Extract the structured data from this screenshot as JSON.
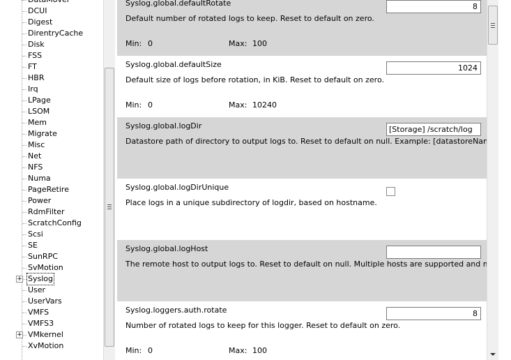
{
  "tree": {
    "items": [
      {
        "label": "DataMover",
        "expandable": false,
        "selected": false
      },
      {
        "label": "DCUI",
        "expandable": false,
        "selected": false
      },
      {
        "label": "Digest",
        "expandable": false,
        "selected": false
      },
      {
        "label": "DirentryCache",
        "expandable": false,
        "selected": false
      },
      {
        "label": "Disk",
        "expandable": false,
        "selected": false
      },
      {
        "label": "FSS",
        "expandable": false,
        "selected": false
      },
      {
        "label": "FT",
        "expandable": false,
        "selected": false
      },
      {
        "label": "HBR",
        "expandable": false,
        "selected": false
      },
      {
        "label": "Irq",
        "expandable": false,
        "selected": false
      },
      {
        "label": "LPage",
        "expandable": false,
        "selected": false
      },
      {
        "label": "LSOM",
        "expandable": false,
        "selected": false
      },
      {
        "label": "Mem",
        "expandable": false,
        "selected": false
      },
      {
        "label": "Migrate",
        "expandable": false,
        "selected": false
      },
      {
        "label": "Misc",
        "expandable": false,
        "selected": false
      },
      {
        "label": "Net",
        "expandable": false,
        "selected": false
      },
      {
        "label": "NFS",
        "expandable": false,
        "selected": false
      },
      {
        "label": "Numa",
        "expandable": false,
        "selected": false
      },
      {
        "label": "PageRetire",
        "expandable": false,
        "selected": false
      },
      {
        "label": "Power",
        "expandable": false,
        "selected": false
      },
      {
        "label": "RdmFilter",
        "expandable": false,
        "selected": false
      },
      {
        "label": "ScratchConfig",
        "expandable": false,
        "selected": false
      },
      {
        "label": "Scsi",
        "expandable": false,
        "selected": false
      },
      {
        "label": "SE",
        "expandable": false,
        "selected": false
      },
      {
        "label": "SunRPC",
        "expandable": false,
        "selected": false
      },
      {
        "label": "SvMotion",
        "expandable": false,
        "selected": false
      },
      {
        "label": "Syslog",
        "expandable": true,
        "selected": true
      },
      {
        "label": "User",
        "expandable": false,
        "selected": false
      },
      {
        "label": "UserVars",
        "expandable": false,
        "selected": false
      },
      {
        "label": "VMFS",
        "expandable": false,
        "selected": false
      },
      {
        "label": "VMFS3",
        "expandable": false,
        "selected": false
      },
      {
        "label": "VMkernel",
        "expandable": true,
        "selected": false
      },
      {
        "label": "XvMotion",
        "expandable": false,
        "selected": false
      }
    ],
    "expander_symbol": "+"
  },
  "settings": [
    {
      "name": "Syslog.global.defaultRotate",
      "control": "number",
      "value": "8",
      "description": "Default number of rotated logs to keep. Reset to default on zero.",
      "min_label": "Min:",
      "min": "0",
      "max_label": "Max:",
      "max": "100",
      "shade": "gray"
    },
    {
      "name": "Syslog.global.defaultSize",
      "control": "number",
      "value": "1024",
      "description": "Default size of logs before rotation, in KiB. Reset to default on zero.",
      "min_label": "Min:",
      "min": "0",
      "max_label": "Max:",
      "max": "10240",
      "shade": "white"
    },
    {
      "name": "Syslog.global.logDir",
      "control": "text",
      "value": "[Storage] /scratch/log",
      "description": "Datastore path of directory to output logs to. Reset to default on null. Example: [datastoreName]/lo..",
      "shade": "gray"
    },
    {
      "name": "Syslog.global.logDirUnique",
      "control": "checkbox",
      "value": "",
      "description": "Place logs in a unique subdirectory of logdir, based on hostname.",
      "shade": "white"
    },
    {
      "name": "Syslog.global.logHost",
      "control": "text",
      "value": "",
      "description": "The remote host to output logs to. Reset to default on null. Multiple hosts are supported and must be",
      "shade": "gray"
    },
    {
      "name": "Syslog.loggers.auth.rotate",
      "control": "number",
      "value": "8",
      "description": "Number of rotated logs to keep for this logger. Reset to default on zero.",
      "min_label": "Min:",
      "min": "0",
      "max_label": "Max:",
      "max": "100",
      "shade": "white"
    }
  ],
  "colors": {
    "row_gray": "#d6d6d6",
    "row_white": "#ffffff"
  }
}
